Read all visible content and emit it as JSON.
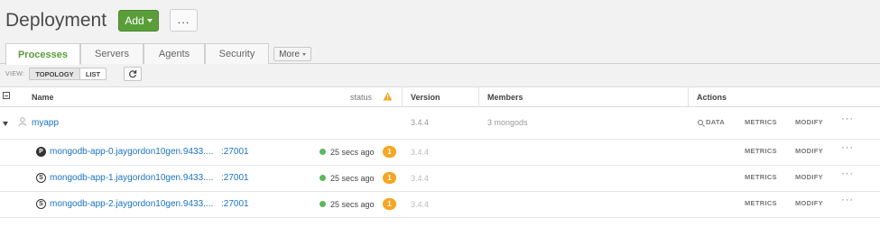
{
  "header": {
    "title": "Deployment",
    "add_label": "Add",
    "more_label": "..."
  },
  "tabs": [
    {
      "label": "Processes",
      "active": true
    },
    {
      "label": "Servers",
      "active": false
    },
    {
      "label": "Agents",
      "active": false
    },
    {
      "label": "Security",
      "active": false
    }
  ],
  "tabs_more_label": "More",
  "view": {
    "label": "VIEW:",
    "options": [
      "TOPOLOGY",
      "LIST"
    ],
    "selected": "TOPOLOGY"
  },
  "table": {
    "columns": {
      "name": "Name",
      "status": "status",
      "version": "Version",
      "members": "Members",
      "actions": "Actions"
    },
    "group": {
      "name": "myapp",
      "version": "3.4.4",
      "members": "3 mongods",
      "actions": {
        "data": "DATA",
        "metrics": "METRICS",
        "modify": "MODIFY",
        "more": "···"
      }
    },
    "processes": [
      {
        "role": "P",
        "host": "mongodb-app-0.jaygordon10gen.9433....",
        "port": ":27001",
        "status": "25 secs ago",
        "warnings": "1",
        "version": "3.4.4",
        "metrics": "METRICS",
        "modify": "MODIFY",
        "more": "···"
      },
      {
        "role": "S",
        "host": "mongodb-app-1.jaygordon10gen.9433....",
        "port": ":27001",
        "status": "25 secs ago",
        "warnings": "1",
        "version": "3.4.4",
        "metrics": "METRICS",
        "modify": "MODIFY",
        "more": "···"
      },
      {
        "role": "S",
        "host": "mongodb-app-2.jaygordon10gen.9433....",
        "port": ":27001",
        "status": "25 secs ago",
        "warnings": "1",
        "version": "3.4.4",
        "metrics": "METRICS",
        "modify": "MODIFY",
        "more": "···"
      }
    ]
  },
  "colors": {
    "accent_green": "#5a9e3a",
    "link_blue": "#1a73c1",
    "status_green": "#5cb85c",
    "warning_orange": "#f5a623"
  }
}
